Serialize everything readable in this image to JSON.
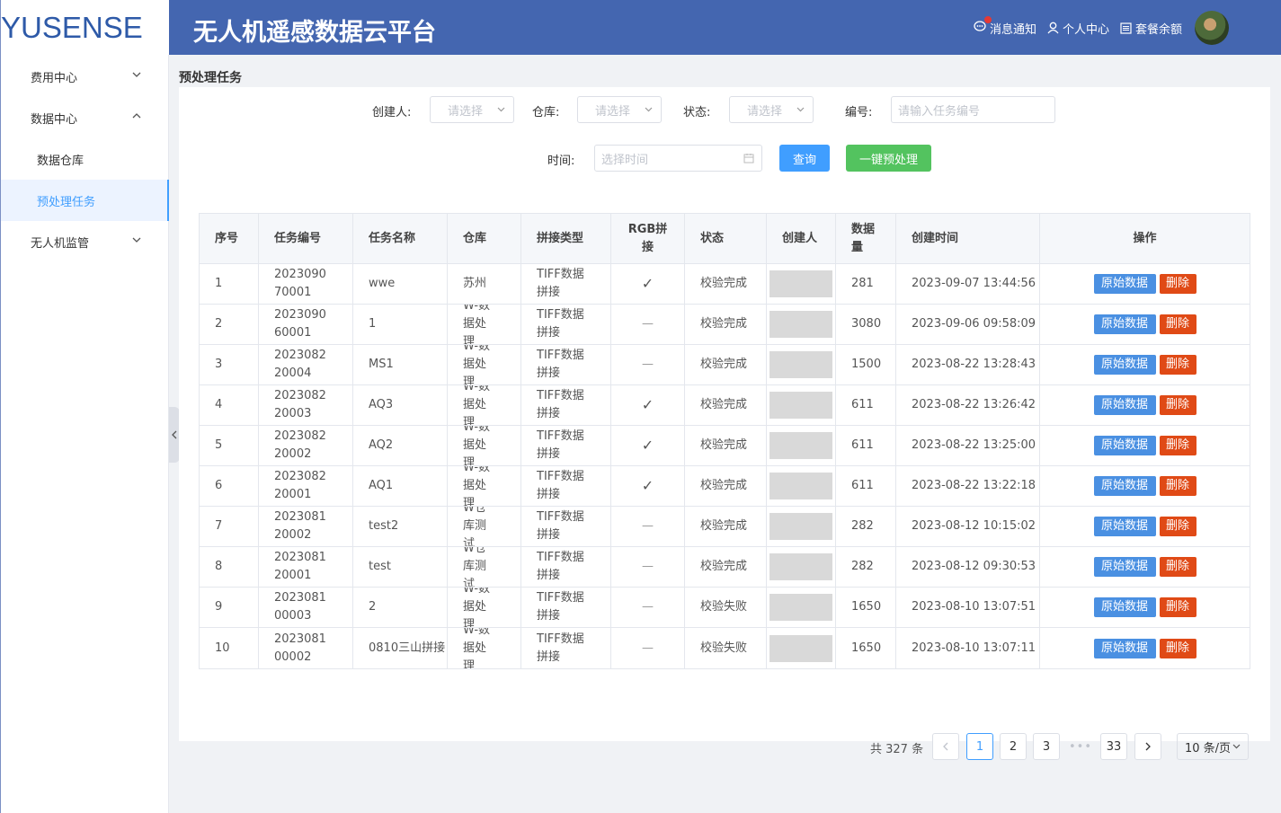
{
  "header": {
    "logo": "YUSENSE",
    "title": "无人机遥感数据云平台",
    "notifications": "消息通知",
    "profile": "个人中心",
    "plan_balance": "套餐余额"
  },
  "sidebar": {
    "items": [
      {
        "label": "费用中心"
      },
      {
        "label": "数据中心"
      },
      {
        "label": "数据仓库"
      },
      {
        "label": "预处理任务"
      },
      {
        "label": "无人机监管"
      }
    ]
  },
  "page": {
    "title": "预处理任务"
  },
  "filters": {
    "creator_label": "创建人:",
    "creator_placeholder": "请选择",
    "warehouse_label": "仓库:",
    "warehouse_placeholder": "请选择",
    "status_label": "状态:",
    "status_placeholder": "请选择",
    "number_label": "编号:",
    "number_placeholder": "请输入任务编号",
    "time_label": "时间:",
    "time_placeholder": "选择时间",
    "query_button": "查询",
    "batch_button": "一键预处理"
  },
  "table": {
    "headers": [
      "序号",
      "任务编号",
      "任务名称",
      "仓库",
      "拼接类型",
      "RGB拼接",
      "状态",
      "创建人",
      "数据量",
      "创建时间",
      "操作"
    ],
    "rgb_yes": "✓",
    "rgb_no": "—",
    "action_raw": "原始数据",
    "action_delete": "删除",
    "rows": [
      {
        "idx": "1",
        "task_no": "202309070001",
        "name": "wwe",
        "warehouse": "苏州",
        "splice_type": "TIFF数据拼接",
        "rgb": true,
        "status": "校验完成",
        "count": "281",
        "created": "2023-09-07 13:44:56"
      },
      {
        "idx": "2",
        "task_no": "202309060001",
        "name": "1",
        "warehouse": "W-数据处理",
        "splice_type": "TIFF数据拼接",
        "rgb": false,
        "status": "校验完成",
        "count": "3080",
        "created": "2023-09-06 09:58:09"
      },
      {
        "idx": "3",
        "task_no": "202308220004",
        "name": "MS1",
        "warehouse": "W-数据处理",
        "splice_type": "TIFF数据拼接",
        "rgb": false,
        "status": "校验完成",
        "count": "1500",
        "created": "2023-08-22 13:28:43"
      },
      {
        "idx": "4",
        "task_no": "202308220003",
        "name": "AQ3",
        "warehouse": "W-数据处理",
        "splice_type": "TIFF数据拼接",
        "rgb": true,
        "status": "校验完成",
        "count": "611",
        "created": "2023-08-22 13:26:42"
      },
      {
        "idx": "5",
        "task_no": "202308220002",
        "name": "AQ2",
        "warehouse": "W-数据处理",
        "splice_type": "TIFF数据拼接",
        "rgb": true,
        "status": "校验完成",
        "count": "611",
        "created": "2023-08-22 13:25:00"
      },
      {
        "idx": "6",
        "task_no": "202308220001",
        "name": "AQ1",
        "warehouse": "W-数据处理",
        "splice_type": "TIFF数据拼接",
        "rgb": true,
        "status": "校验完成",
        "count": "611",
        "created": "2023-08-22 13:22:18"
      },
      {
        "idx": "7",
        "task_no": "202308120002",
        "name": "test2",
        "warehouse": "W仓库测试",
        "splice_type": "TIFF数据拼接",
        "rgb": false,
        "status": "校验完成",
        "count": "282",
        "created": "2023-08-12 10:15:02"
      },
      {
        "idx": "8",
        "task_no": "202308120001",
        "name": "test",
        "warehouse": "W仓库测试",
        "splice_type": "TIFF数据拼接",
        "rgb": false,
        "status": "校验完成",
        "count": "282",
        "created": "2023-08-12 09:30:53"
      },
      {
        "idx": "9",
        "task_no": "202308100003",
        "name": "2",
        "warehouse": "W-数据处理",
        "splice_type": "TIFF数据拼接",
        "rgb": false,
        "status": "校验失败",
        "count": "1650",
        "created": "2023-08-10 13:07:51"
      },
      {
        "idx": "10",
        "task_no": "202308100002",
        "name": "0810三山拼接",
        "warehouse": "W-数据处理",
        "splice_type": "TIFF数据拼接",
        "rgb": false,
        "status": "校验失败",
        "count": "1650",
        "created": "2023-08-10 13:07:11"
      }
    ]
  },
  "pagination": {
    "total": "共 327 条",
    "pages": [
      "1",
      "2",
      "3"
    ],
    "ellipsis": "•••",
    "last_page": "33",
    "current_page": "1",
    "page_size": "10 条/页"
  },
  "colors": {
    "header_bg": "#4466b0",
    "accent": "#409eff",
    "success": "#53c35f",
    "danger": "#e04a16"
  }
}
